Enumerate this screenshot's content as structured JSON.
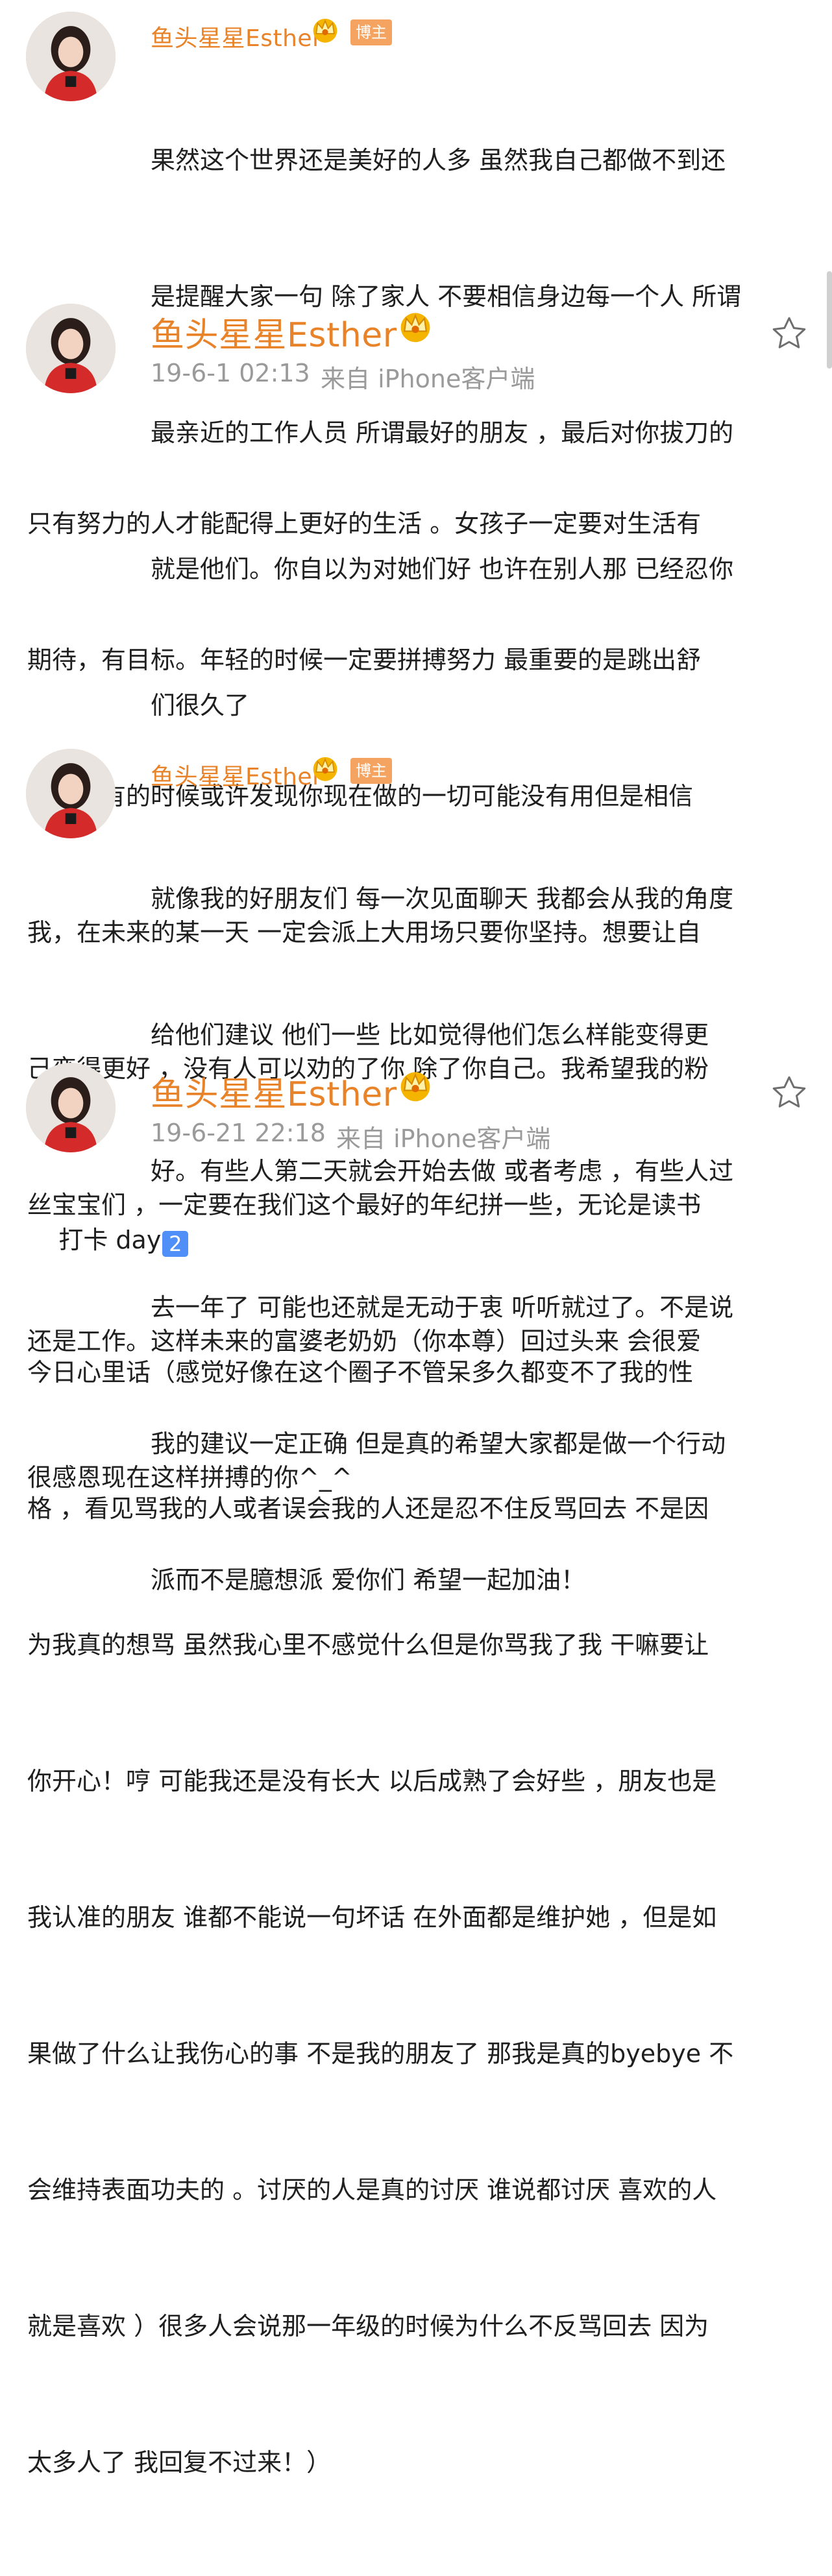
{
  "colors": {
    "name": "#e8832a",
    "badge_bg": "#f4a460",
    "meta": "#9a9a9a",
    "text": "#1f1f1f"
  },
  "entries": [
    {
      "kind": "reply",
      "username": "鱼头星星Esther",
      "badge": "博主",
      "lines": [
        "果然这个世界还是美好的人多 虽然我自己都做不到还",
        "是提醒大家一句 除了家人 不要相信身边每一个人 所谓",
        "最亲近的工作人员 所谓最好的朋友 ，最后对你拔刀的",
        "就是他们。你自以为对她们好 也许在别人那 已经忍你",
        "们很久了"
      ]
    },
    {
      "kind": "post",
      "username": "鱼头星星Esther",
      "timestamp": "19-6-1 02:13",
      "source": "来自 iPhone客户端",
      "lines": [
        "只有努力的人才能配得上更好的生活 。女孩子一定要对生活有",
        "期待，有目标。年轻的时候一定要拼搏努力 最重要的是跳出舒",
        "适圈。有的时候或许发现你现在做的一切可能没有用但是相信",
        "我，在未来的某一天 一定会派上大用场只要你坚持。想要让自",
        "己变得更好 ，没有人可以劝的了你 除了你自己。我希望我的粉",
        "丝宝宝们 ，一定要在我们这个最好的年纪拼一些，无论是读书",
        "还是工作。这样未来的富婆老奶奶（你本尊）回过头来 会很爱",
        "很感恩现在这样拼搏的你^_^"
      ]
    },
    {
      "kind": "reply",
      "username": "鱼头星星Esther",
      "badge": "博主",
      "lines": [
        "就像我的好朋友们 每一次见面聊天 我都会从我的角度",
        "给他们建议 他们一些 比如觉得他们怎么样能变得更",
        "好。有些人第二天就会开始去做 或者考虑 ，有些人过",
        "去一年了 可能也还就是无动于衷 听听就过了。不是说",
        "我的建议一定正确 但是真的希望大家都是做一个行动",
        "派而不是臆想派 爱你们 希望一起加油！"
      ]
    },
    {
      "kind": "post",
      "username": "鱼头星星Esther",
      "timestamp": "19-6-21 22:18",
      "source": "来自 iPhone客户端",
      "first_line": "打卡 day",
      "first_line_badge": "2",
      "lines": [
        "今日心里话（感觉好像在这个圈子不管呆多久都变不了我的性",
        "格 ，看见骂我的人或者误会我的人还是忍不住反骂回去 不是因",
        "为我真的想骂 虽然我心里不感觉什么但是你骂我了我 干嘛要让",
        "你开心！哼 可能我还是没有长大 以后成熟了会好些 ，朋友也是",
        "我认准的朋友 谁都不能说一句坏话 在外面都是维护她 ，但是如",
        "果做了什么让我伤心的事 不是我的朋友了 那我是真的byebye 不",
        "会维持表面功夫的 。讨厌的人是真的讨厌 谁说都讨厌 喜欢的人",
        "就是喜欢 ）很多人会说那一年级的时候为什么不反骂回去 因为",
        "太多人了 我回复不过来！）"
      ]
    }
  ]
}
